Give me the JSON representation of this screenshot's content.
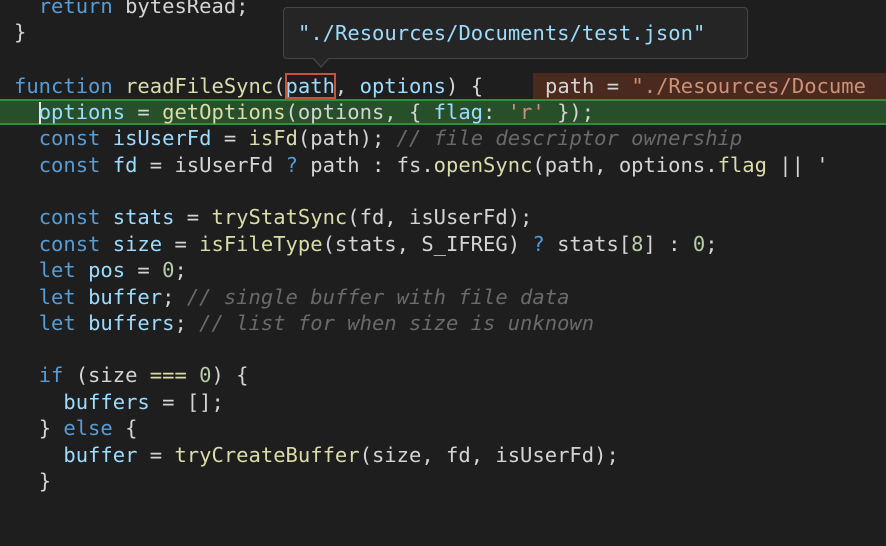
{
  "tooltip": {
    "text": "\"./Resources/Documents/test.json\""
  },
  "inline_value": {
    "name": "path",
    "eq": " = ",
    "value": "\"./Resources/Docume"
  },
  "lines": {
    "l0": {
      "kw": "return",
      "rest": " bytesRead;"
    },
    "l1": {
      "text": "}"
    },
    "l2": {
      "kw": "function",
      "fn": "readFileSync",
      "p1": "path",
      "sep": ", ",
      "p2": "options",
      "tail": ") {"
    },
    "l3": {
      "a": "options",
      "b": " = ",
      "c": "getOptions",
      "d": "(options, { ",
      "e": "flag",
      "f": ": ",
      "g": "'r'",
      "h": " });"
    },
    "l4": {
      "kw": "const",
      "name": "isUserFd",
      "eq": " = ",
      "fn": "isFd",
      "args": "(path); ",
      "cmt": "// file descriptor ownership"
    },
    "l5": {
      "kw": "const",
      "name": "fd",
      "eq": " = ",
      "a": "isUserFd ",
      "q": "?",
      "b": " path : fs.",
      "fn": "openSync",
      "c": "(path, options.",
      "d": "flag",
      "e": " || '"
    },
    "l6": {
      "kw": "const",
      "name": "stats",
      "eq": " = ",
      "fn": "tryStatSync",
      "args": "(fd, isUserFd);"
    },
    "l7": {
      "kw": "const",
      "name": "size",
      "eq": " = ",
      "fn": "isFileType",
      "a": "(stats, S_IFREG) ",
      "q": "?",
      "b": " stats[",
      "n1": "8",
      "c": "] : ",
      "n2": "0",
      "d": ";"
    },
    "l8": {
      "kw": "let",
      "name": "pos",
      "eq": " = ",
      "n": "0",
      "end": ";"
    },
    "l9": {
      "kw": "let",
      "name": "buffer",
      "end": "; ",
      "cmt": "// single buffer with file data"
    },
    "l10": {
      "kw": "let",
      "name": "buffers",
      "end": "; ",
      "cmt": "// list for when size is unknown"
    },
    "l11": {
      "kw": "if",
      "a": " (size ",
      "op": "===",
      "b": " ",
      "n": "0",
      "c": ") {"
    },
    "l12": {
      "name": "buffers",
      "eq": " = ",
      "rest": "[];"
    },
    "l13": {
      "a": "} ",
      "kw": "else",
      "b": " {"
    },
    "l14": {
      "name": "buffer",
      "eq": " = ",
      "fn": "tryCreateBuffer",
      "args": "(size, fd, isUserFd);"
    },
    "l15": {
      "text": "}"
    }
  }
}
